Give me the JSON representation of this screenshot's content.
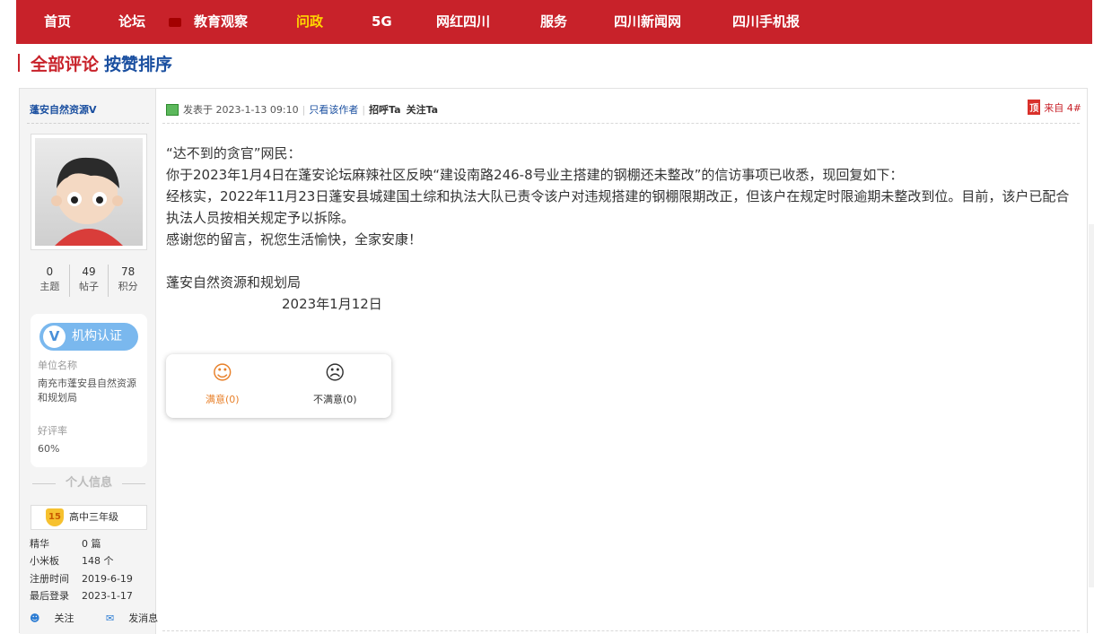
{
  "nav": {
    "items": [
      {
        "label": "首页",
        "active": false
      },
      {
        "label": "论坛",
        "active": false
      },
      {
        "label": "教育观察",
        "active": false
      },
      {
        "label": "问政",
        "active": true
      },
      {
        "label": "5G",
        "active": false
      },
      {
        "label": "网红四川",
        "active": false
      },
      {
        "label": "服务",
        "active": false
      },
      {
        "label": "四川新闻网",
        "active": false
      },
      {
        "label": "四川手机报",
        "active": false
      }
    ]
  },
  "heading": {
    "all_comments": "全部评论",
    "sort_by_likes": "按赞排序"
  },
  "author": {
    "name": "蓬安自然资源V",
    "stats": [
      {
        "value": "0",
        "label": "主题"
      },
      {
        "value": "49",
        "label": "帖子"
      },
      {
        "value": "78",
        "label": "积分"
      }
    ],
    "cert": {
      "badge": "机构认证",
      "unit_label": "单位名称",
      "unit_value": "南充市蓬安县自然资源和规划局",
      "rating_label": "好评率",
      "rating_value": "60%"
    },
    "personal_title": "个人信息",
    "grade": {
      "level": "15",
      "name": "高中三年级"
    },
    "info": [
      {
        "k": "精华",
        "v": "0 篇"
      },
      {
        "k": "小米板",
        "v": "148 个"
      },
      {
        "k": "注册时间",
        "v": "2019-6-19"
      },
      {
        "k": "最后登录",
        "v": "2023-1-17"
      }
    ],
    "follow_label": "关注",
    "message_label": "发消息"
  },
  "post": {
    "posted_at": "发表于 2023-1-13 09:10",
    "only_author": "只看该作者",
    "greet": "招呼Ta",
    "follow": "关注Ta",
    "floor": "来自 4#",
    "top_icon": "顶",
    "lines": [
      "“达不到的贪官”网民：",
      "你于2023年1月4日在蓬安论坛麻辣社区反映“建设南路246-8号业主搭建的钢棚还未整改”的信访事项已收悉，现回复如下：",
      "经核实，2022年11月23日蓬安县城建国土综和执法大队已责令该户对违规搭建的钢棚限期改正，但该户在规定时限逾期未整改到位。目前，该户已配合执法人员按相关规定予以拆除。",
      "感谢您的留言，祝您生活愉快，全家安康！",
      "",
      "蓬安自然资源和规划局"
    ],
    "date_line": "2023年1月12日",
    "vote": {
      "satisfied": "满意(0)",
      "unsatisfied": "不满意(0)",
      "satisfied_icon": "smile-icon",
      "unsatisfied_icon": "frown-icon"
    }
  },
  "colors": {
    "nav_bg": "#c8222a",
    "nav_active": "#ffd800",
    "link": "#1a4fa0",
    "accent": "#e8812b"
  }
}
